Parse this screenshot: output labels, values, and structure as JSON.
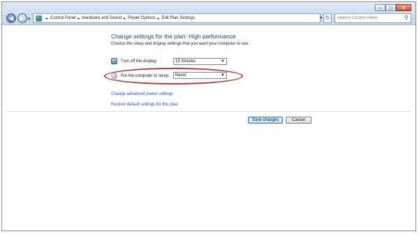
{
  "address_bar": {
    "crumbs": [
      "Control Panel",
      "Hardware and Sound",
      "Power Options",
      "Edit Plan Settings"
    ],
    "separator": "▸"
  },
  "search": {
    "placeholder": "Search Control Panel"
  },
  "icons": {
    "back": "back-arrow-icon",
    "forward": "forward-arrow-icon",
    "refresh": "refresh-icon",
    "search": "magnifier-icon",
    "display": "monitor-icon",
    "sleep": "moon-icon"
  },
  "main": {
    "heading": "Change settings for the plan: High performance",
    "subtitle": "Choose the sleep and display settings that you want your computer to use.",
    "display_label": "Turn off the display:",
    "display_value": "15 minutes",
    "sleep_label": "Put the computer to sleep:",
    "sleep_value": "Never",
    "link_advanced": "Change advanced power settings",
    "link_restore": "Restore default settings for this plan"
  },
  "buttons": {
    "save": "Save changes",
    "cancel": "Cancel"
  },
  "colors": {
    "heading": "#1e3d8a",
    "link": "#1f4fb0",
    "highlight_ellipse": "#b13a3a"
  }
}
